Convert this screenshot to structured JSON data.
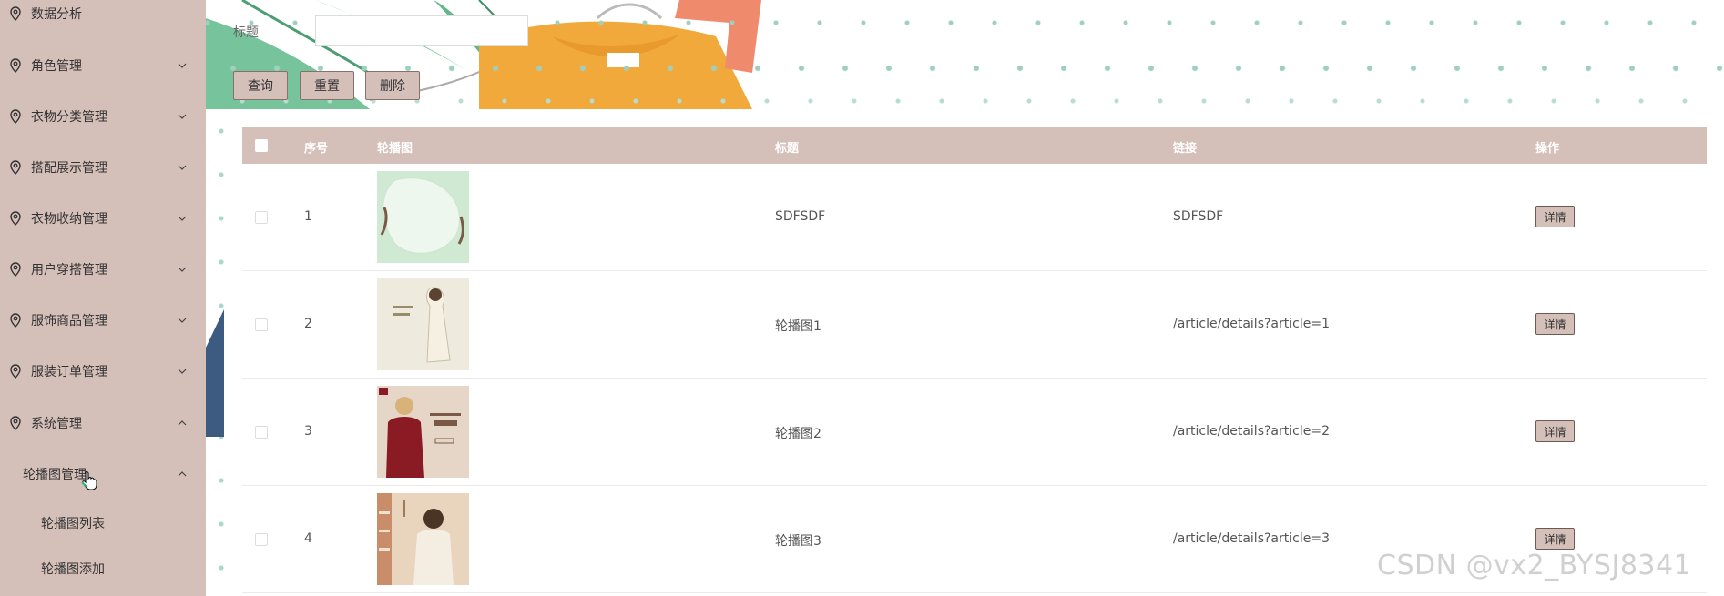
{
  "sidebar": {
    "items": [
      {
        "label": "数据分析",
        "expanded": null
      },
      {
        "label": "角色管理",
        "expanded": false
      },
      {
        "label": "衣物分类管理",
        "expanded": false
      },
      {
        "label": "搭配展示管理",
        "expanded": false
      },
      {
        "label": "衣物收纳管理",
        "expanded": false
      },
      {
        "label": "用户穿搭管理",
        "expanded": false
      },
      {
        "label": "服饰商品管理",
        "expanded": false
      },
      {
        "label": "服装订单管理",
        "expanded": false
      },
      {
        "label": "系统管理",
        "expanded": true
      }
    ],
    "submenu": {
      "label": "轮播图管理",
      "expanded": true
    },
    "subitems": [
      "轮播图列表",
      "轮播图添加"
    ]
  },
  "search": {
    "label": "标题",
    "value": ""
  },
  "buttons": {
    "query": "查询",
    "reset": "重置",
    "delete": "删除"
  },
  "table": {
    "columns": {
      "index": "序号",
      "image": "轮播图",
      "title": "标题",
      "link": "链接",
      "actions": "操作"
    },
    "rows": [
      {
        "index": "1",
        "title": "SDFSDF",
        "link": "SDFSDF",
        "action": "详情"
      },
      {
        "index": "2",
        "title": "轮播图1",
        "link": "/article/details?article=1",
        "action": "详情"
      },
      {
        "index": "3",
        "title": "轮播图2",
        "link": "/article/details?article=2",
        "action": "详情"
      },
      {
        "index": "4",
        "title": "轮播图3",
        "link": "/article/details?article=3",
        "action": "详情"
      }
    ]
  },
  "watermark": "CSDN @vx2_BYSJ8341",
  "colors": {
    "theme": "#d5bfb9",
    "button_border": "#8a7069",
    "banner_green": "#5fb88a",
    "banner_orange": "#f2a93b",
    "banner_coral": "#f08a6c"
  }
}
